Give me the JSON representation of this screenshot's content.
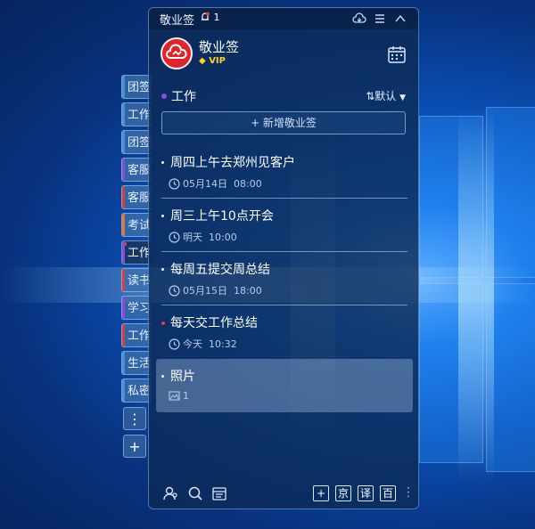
{
  "window": {
    "title": "敬业签",
    "notif_count": "1"
  },
  "user": {
    "name": "敬业签",
    "badge": "VIP"
  },
  "side_tabs": [
    {
      "label": "团签",
      "stripe": "#4a90d9"
    },
    {
      "label": "工作",
      "stripe": "#4a90d9"
    },
    {
      "label": "团签",
      "stripe": "#4a90d9"
    },
    {
      "label": "客服",
      "stripe": "#8a4bd8"
    },
    {
      "label": "客服",
      "stripe": "#e03a3a"
    },
    {
      "label": "考试",
      "stripe": "#e07a2a"
    },
    {
      "label": "工作",
      "stripe": "#8a4bd8"
    },
    {
      "label": "读书",
      "stripe": "#e03a3a"
    },
    {
      "label": "学习",
      "stripe": "#8a4bd8"
    },
    {
      "label": "工作",
      "stripe": "#e03a3a"
    },
    {
      "label": "生活",
      "stripe": "#4a90d9"
    },
    {
      "label": "私密",
      "stripe": "#4a90d9"
    }
  ],
  "section": {
    "title": "工作",
    "sort_label": "⇅默认"
  },
  "add_button": "+ 新增敬业签",
  "notes": [
    {
      "title": "周四上午去郑州见客户",
      "date": "05月14日",
      "time": "08:00",
      "bullet": "white"
    },
    {
      "title": "周三上午10点开会",
      "date": "明天",
      "time": "10:00",
      "bullet": "white"
    },
    {
      "title": "每周五提交周总结",
      "date": "05月15日",
      "time": "18:00",
      "bullet": "white"
    },
    {
      "title": "每天交工作总结",
      "date": "今天",
      "time": "10:32",
      "bullet": "red"
    },
    {
      "title": "照片",
      "attachments": "1",
      "bullet": "white"
    }
  ],
  "footer": {
    "btn_jing": "京",
    "btn_yi": "译",
    "btn_bai": "百"
  },
  "colors": {
    "accent_red": "#e0242a",
    "vip_gold": "#ffd21f",
    "panel": "#0c2a56"
  }
}
